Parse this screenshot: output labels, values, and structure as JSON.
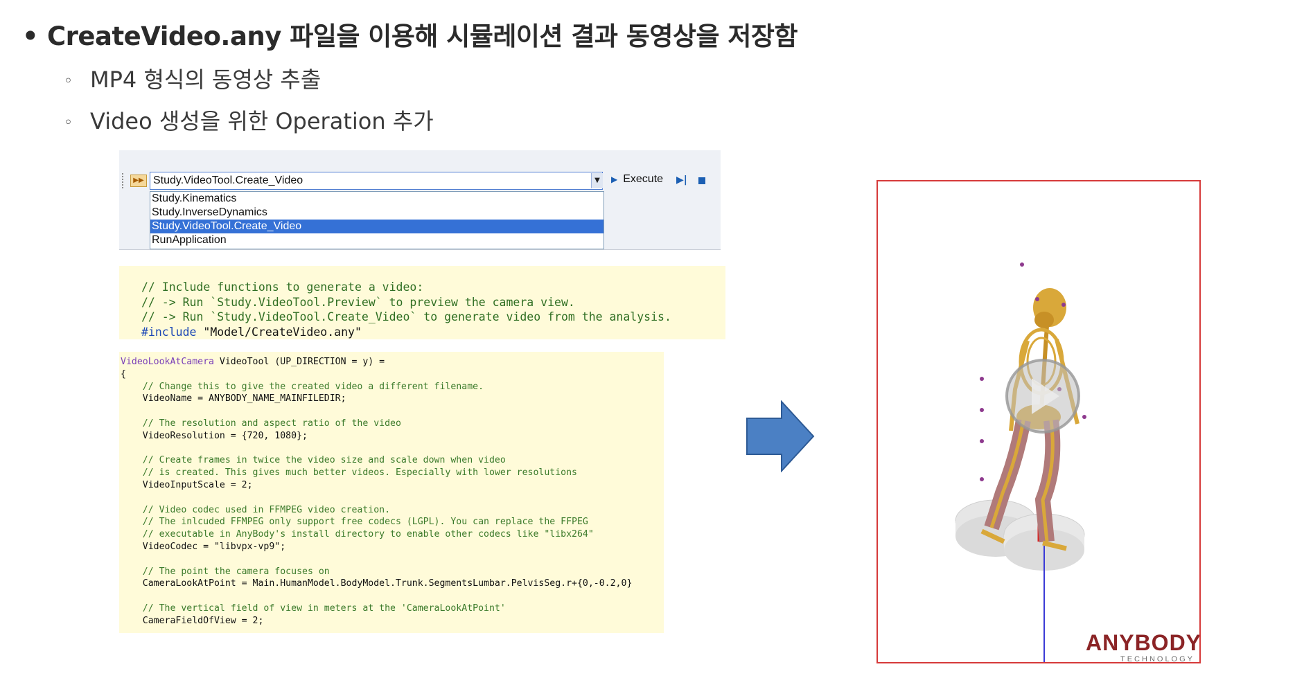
{
  "slide": {
    "bullet_main": "CreateVideo.any 파일을 이용해 시뮬레이션 결과 동영상을 저장함",
    "sub_bullets": [
      "MP4 형식의 동영상 추출",
      "Video 생성을 위한 Operation 추가"
    ]
  },
  "toolbar": {
    "combo_value": "Study.VideoTool.Create_Video",
    "execute_label": "Execute",
    "dropdown_items": [
      "Study.Kinematics",
      "Study.InverseDynamics",
      "Study.VideoTool.Create_Video",
      "RunApplication"
    ],
    "selected_index": 2
  },
  "code1": {
    "comment1": "// Include functions to generate a video:",
    "comment2": "// -> Run `Study.VideoTool.Preview` to preview the camera view.",
    "comment3": "// -> Run `Study.VideoTool.Create_Video` to generate video from the analysis.",
    "include_kw": "#include",
    "include_path": " \"Model/CreateVideo.any\""
  },
  "code2": {
    "lines": [
      {
        "type": "head",
        "cls": "VideoLookAtCamera",
        "rest": " VideoTool (UP_DIRECTION = y) ="
      },
      {
        "type": "code",
        "text": "{"
      },
      {
        "type": "comment",
        "text": "    // Change this to give the created video a different filename."
      },
      {
        "type": "code",
        "text": "    VideoName = ANYBODY_NAME_MAINFILEDIR;"
      },
      {
        "type": "code",
        "text": ""
      },
      {
        "type": "comment",
        "text": "    // The resolution and aspect ratio of the video"
      },
      {
        "type": "code",
        "text": "    VideoResolution = {720, 1080};"
      },
      {
        "type": "code",
        "text": ""
      },
      {
        "type": "comment",
        "text": "    // Create frames in twice the video size and scale down when video"
      },
      {
        "type": "comment",
        "text": "    // is created. This gives much better videos. Especially with lower resolutions"
      },
      {
        "type": "code",
        "text": "    VideoInputScale = 2;"
      },
      {
        "type": "code",
        "text": ""
      },
      {
        "type": "comment",
        "text": "    // Video codec used in FFMPEG video creation."
      },
      {
        "type": "comment",
        "text": "    // The inlcuded FFMPEG only support free codecs (LGPL). You can replace the FFPEG"
      },
      {
        "type": "comment",
        "text": "    // executable in AnyBody's install directory to enable other codecs like \"libx264\""
      },
      {
        "type": "code",
        "text": "    VideoCodec = \"libvpx-vp9\";"
      },
      {
        "type": "code",
        "text": ""
      },
      {
        "type": "comment",
        "text": "    // The point the camera focuses on"
      },
      {
        "type": "code",
        "text": "    CameraLookAtPoint = Main.HumanModel.BodyModel.Trunk.SegmentsLumbar.PelvisSeg.r+{0,-0.2,0}"
      },
      {
        "type": "code",
        "text": ""
      },
      {
        "type": "comment",
        "text": "    // The vertical field of view in meters at the 'CameraLookAtPoint'"
      },
      {
        "type": "code",
        "text": "    CameraFieldOfView = 2;"
      }
    ]
  },
  "video": {
    "logo_main": "ANYBODY",
    "logo_sub": "TECHNOLOGY",
    "frame_color": "#d63a3a",
    "bone_color": "#d9a83a",
    "muscle_color": "#b07a7a"
  },
  "icons": [
    "play-icon",
    "arrow-right-icon",
    "execute-icon",
    "step-icon",
    "stop-icon",
    "dropdown-chevron-icon"
  ]
}
